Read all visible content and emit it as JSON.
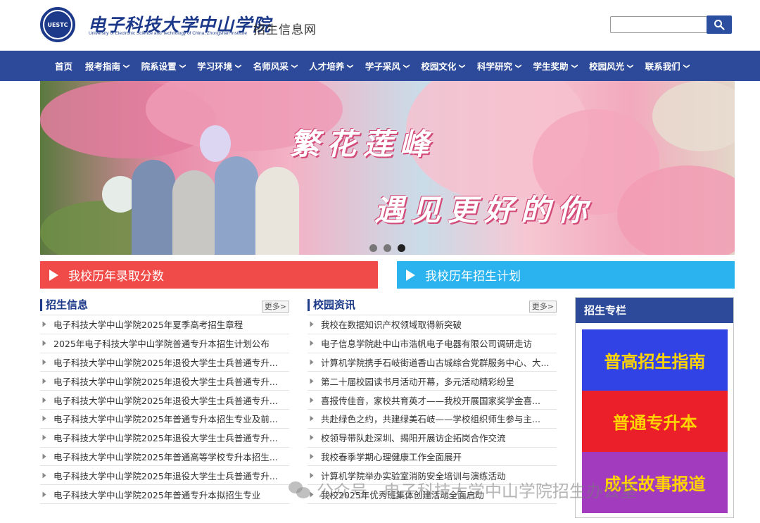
{
  "header": {
    "logo_cn": "电子科技大学中山学院",
    "logo_en": "University of Electronic Science and Technology of China, Zhongshan Institute",
    "logo_seal_text": "UESTC",
    "site_name": "招生信息网",
    "search": {
      "value": "",
      "placeholder": ""
    }
  },
  "nav": {
    "items": [
      {
        "label": "首页",
        "dropdown": false
      },
      {
        "label": "报考指南",
        "dropdown": true
      },
      {
        "label": "院系设置",
        "dropdown": true
      },
      {
        "label": "学习环境",
        "dropdown": true
      },
      {
        "label": "名师风采",
        "dropdown": true
      },
      {
        "label": "人才培养",
        "dropdown": true
      },
      {
        "label": "学子采风",
        "dropdown": true
      },
      {
        "label": "校园文化",
        "dropdown": true
      },
      {
        "label": "科学研究",
        "dropdown": true
      },
      {
        "label": "学生奖助",
        "dropdown": true
      },
      {
        "label": "校园风光",
        "dropdown": true
      },
      {
        "label": "联系我们",
        "dropdown": true
      }
    ]
  },
  "banner": {
    "line1": "繁花莲峰",
    "line2": "遇见更好的你",
    "slides": 3,
    "active_slide": 3
  },
  "quick_links": {
    "left": "我校历年录取分数",
    "right": "我校历年招生计划",
    "left_color": "#f04b48",
    "right_color": "#2bb3ef"
  },
  "admissions": {
    "title": "招生信息",
    "more": "更多>",
    "items": [
      "电子科技大学中山学院2025年夏季高考招生章程",
      "2025年电子科技大学中山学院普通专升本招生计划公布",
      "电子科技大学中山学院2025年退役大学生士兵普通专升...",
      "电子科技大学中山学院2025年退役大学生士兵普通专升...",
      "电子科技大学中山学院2025年退役大学生士兵普通专升...",
      "电子科技大学中山学院2025年普通专升本招生专业及前...",
      "电子科技大学中山学院2025年退役大学生士兵普通专升...",
      "电子科技大学中山学院2025年普通高等学校专升本招生...",
      "电子科技大学中山学院2025年退役大学生士兵普通专升...",
      "电子科技大学中山学院2025年普通专升本拟招生专业"
    ]
  },
  "campus_news": {
    "title": "校园资讯",
    "more": "更多>",
    "items": [
      "我校在数据知识产权领域取得新突破",
      "电子信息学院赴中山市浩帆电子电器有限公司调研走访",
      "计算机学院携手石岐街道香山古城综合党群服务中心、大...",
      "第二十届校园读书月活动开幕，多元活动精彩纷呈",
      "喜报传佳音，家校共育英才——我校开展国家奖学金喜...",
      "共赴绿色之约，共建绿美石岐——学校组织师生参与主...",
      "校领导带队赴深圳、揭阳开展访企拓岗合作交流",
      "我校春季学期心理健康工作全面展开",
      "计算机学院举办实验室消防安全培训与演练活动",
      "我校2025年优秀班集体创建活动全面启动"
    ]
  },
  "special": {
    "title": "招生专栏",
    "cards": [
      {
        "label": "普高招生指南",
        "color": "#3243e6"
      },
      {
        "label": "普通专升本",
        "color": "#ea1f2a"
      },
      {
        "label": "成长故事报道",
        "color": "#a33bbf"
      }
    ]
  },
  "watermark": {
    "text": "公众号 · 电子科技大学中山学院招生办公室",
    "icon": "wechat-icon"
  },
  "colors": {
    "nav_bg": "#2c4a99",
    "brand": "#1d3a8a",
    "guide_text": "#ffd400"
  }
}
